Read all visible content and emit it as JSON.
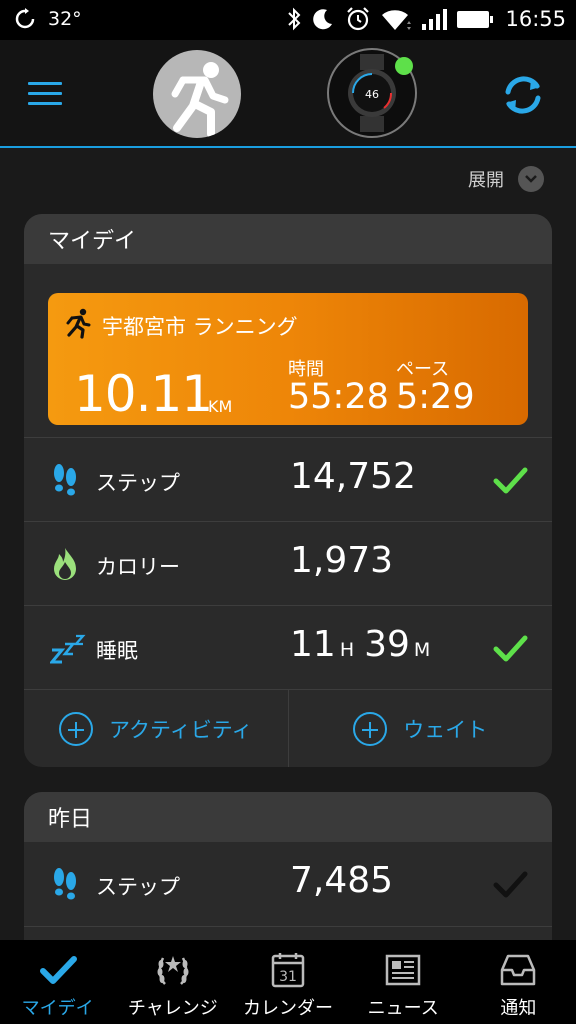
{
  "status_bar": {
    "temperature": "32°",
    "time": "16:55"
  },
  "header": {
    "expand_label": "展開"
  },
  "device": {
    "watch_face_number": "46"
  },
  "my_day": {
    "title": "マイデイ",
    "activity": {
      "name": "宇都宮市 ランニング",
      "distance": "10.11",
      "distance_unit": "KM",
      "time_label": "時間",
      "time_value": "55:28",
      "pace_label": "ペース",
      "pace_value": "5:29"
    },
    "metrics": [
      {
        "label": "ステップ",
        "value": "14,752",
        "goal_met": true
      },
      {
        "label": "カロリー",
        "value": "1,973",
        "goal_met": false
      },
      {
        "label": "睡眠",
        "hours": "11",
        "hours_unit": "H",
        "minutes": "39",
        "minutes_unit": "M",
        "goal_met": true
      }
    ],
    "actions": [
      {
        "label": "アクティビティ"
      },
      {
        "label": "ウェイト"
      }
    ]
  },
  "yesterday": {
    "title": "昨日",
    "metrics": [
      {
        "label": "ステップ",
        "value": "7,485",
        "goal_met": true
      }
    ]
  },
  "bottom_nav": [
    {
      "label": "マイデイ",
      "icon": "check-icon",
      "active": true
    },
    {
      "label": "チャレンジ",
      "icon": "laurel-icon",
      "active": false
    },
    {
      "label": "カレンダー",
      "icon": "calendar-icon",
      "active": false,
      "calendar_day": "31"
    },
    {
      "label": "ニュース",
      "icon": "news-icon",
      "active": false
    },
    {
      "label": "通知",
      "icon": "inbox-icon",
      "active": false
    }
  ],
  "colors": {
    "accent": "#2aa8e8",
    "activity_orange": "#f59a10",
    "goal_green": "#5ee04a"
  }
}
